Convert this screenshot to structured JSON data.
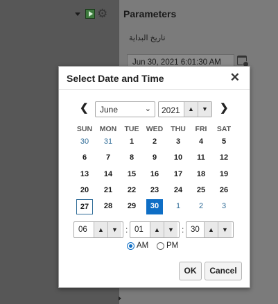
{
  "panel": {
    "title": "Parameters",
    "start_date_label": "تاريخ البداية",
    "start_date_value": "Jun 30, 2021 6:01:30 AM"
  },
  "toolbar": {
    "icons": [
      "dropdown-caret-icon",
      "run-icon",
      "gear-icon"
    ]
  },
  "dialog": {
    "title": "Select Date and Time",
    "close_glyph": "✕",
    "prev_glyph": "❮",
    "next_glyph": "❯",
    "month": "June",
    "year": "2021",
    "weekdays": [
      "SUN",
      "MON",
      "TUE",
      "WED",
      "THU",
      "FRI",
      "SAT"
    ],
    "weeks": [
      [
        {
          "d": "30",
          "o": 1
        },
        {
          "d": "31",
          "o": 1
        },
        {
          "d": "1"
        },
        {
          "d": "2"
        },
        {
          "d": "3"
        },
        {
          "d": "4"
        },
        {
          "d": "5"
        }
      ],
      [
        {
          "d": "6"
        },
        {
          "d": "7"
        },
        {
          "d": "8"
        },
        {
          "d": "9"
        },
        {
          "d": "10"
        },
        {
          "d": "11"
        },
        {
          "d": "12"
        }
      ],
      [
        {
          "d": "13"
        },
        {
          "d": "14"
        },
        {
          "d": "15"
        },
        {
          "d": "16"
        },
        {
          "d": "17"
        },
        {
          "d": "18"
        },
        {
          "d": "19"
        }
      ],
      [
        {
          "d": "20"
        },
        {
          "d": "21"
        },
        {
          "d": "22"
        },
        {
          "d": "23"
        },
        {
          "d": "24"
        },
        {
          "d": "25"
        },
        {
          "d": "26"
        }
      ],
      [
        {
          "d": "27",
          "today": 1
        },
        {
          "d": "28"
        },
        {
          "d": "29"
        },
        {
          "d": "30",
          "sel": 1
        },
        {
          "d": "1",
          "o": 1
        },
        {
          "d": "2",
          "o": 1
        },
        {
          "d": "3",
          "o": 1
        }
      ]
    ],
    "time": {
      "hour": "06",
      "minute": "01",
      "second": "30",
      "separator": ":"
    },
    "am_label": "AM",
    "pm_label": "PM",
    "meridiem_selected": "AM",
    "ok_label": "OK",
    "cancel_label": "Cancel",
    "spin_up": "▲",
    "spin_down": "▼"
  },
  "colors": {
    "selected_day": "#0e6ec5",
    "other_month_day": "#2e6b97",
    "overlay": "#5b5b5b"
  }
}
